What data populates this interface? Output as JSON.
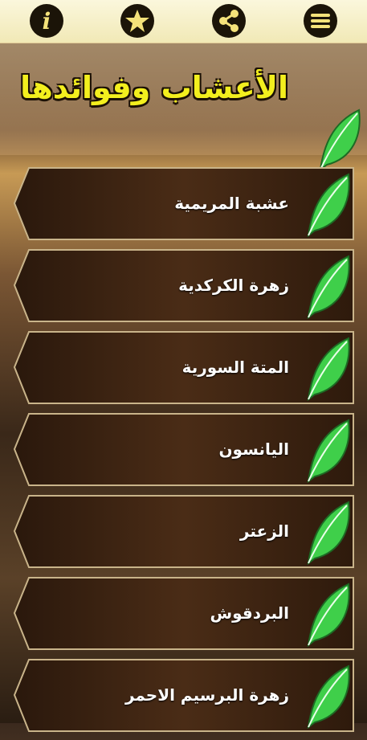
{
  "app": {
    "title": "الأعشاب وفوائدها"
  },
  "toolbar": {
    "icons": [
      "info-icon",
      "star-icon",
      "share-icon",
      "menu-icon"
    ]
  },
  "colors": {
    "title": "#f3ef1e",
    "leaf": "#3fcf4a",
    "topbar": "#f6f0c6",
    "icon_bg": "#1b1408",
    "icon_fg": "#f4e27a"
  },
  "items": [
    {
      "label": "عشبة المريمية"
    },
    {
      "label": "زهرة الكركدية"
    },
    {
      "label": "المتة السورية"
    },
    {
      "label": "اليانسون"
    },
    {
      "label": "الزعتر"
    },
    {
      "label": "البردقوش"
    },
    {
      "label": "زهرة البرسيم الاحمر"
    }
  ]
}
